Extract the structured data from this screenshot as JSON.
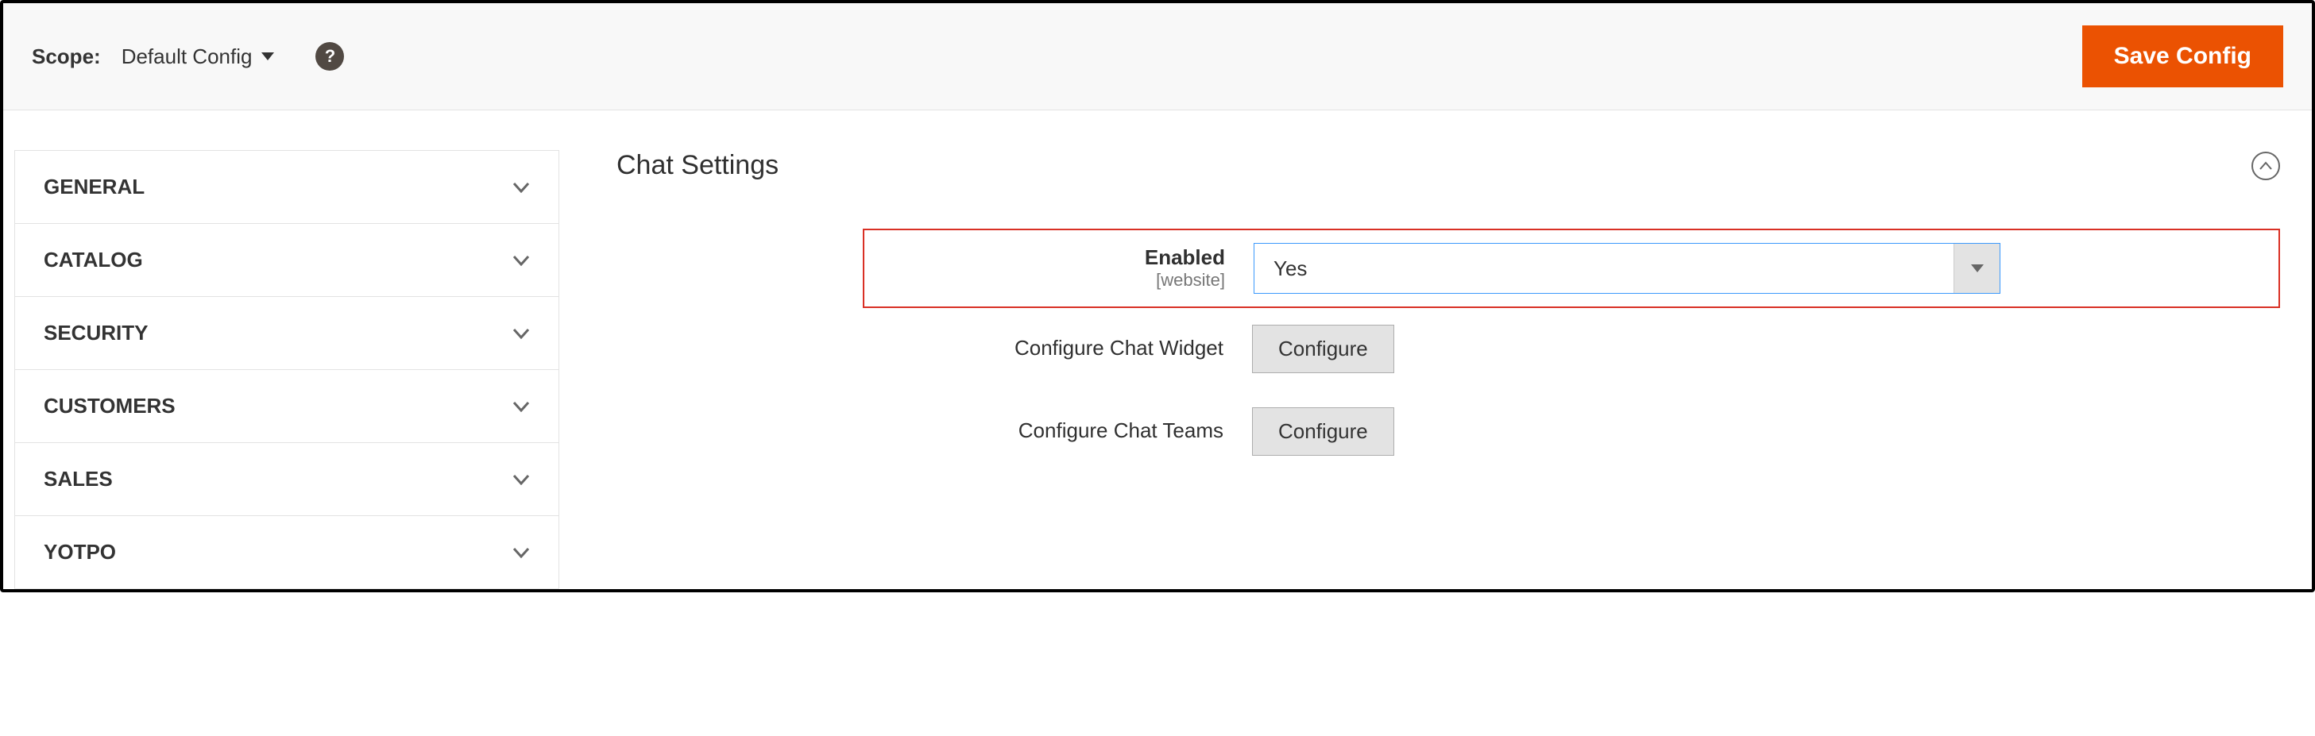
{
  "header": {
    "scope_label": "Scope:",
    "scope_value": "Default Config",
    "save_label": "Save Config"
  },
  "sidebar": {
    "items": [
      {
        "label": "GENERAL"
      },
      {
        "label": "CATALOG"
      },
      {
        "label": "SECURITY"
      },
      {
        "label": "CUSTOMERS"
      },
      {
        "label": "SALES"
      },
      {
        "label": "YOTPO"
      }
    ]
  },
  "section": {
    "title": "Chat Settings"
  },
  "fields": {
    "enabled": {
      "label": "Enabled",
      "scope": "[website]",
      "value": "Yes"
    },
    "widget": {
      "label": "Configure Chat Widget",
      "button": "Configure"
    },
    "teams": {
      "label": "Configure Chat Teams",
      "button": "Configure"
    }
  }
}
